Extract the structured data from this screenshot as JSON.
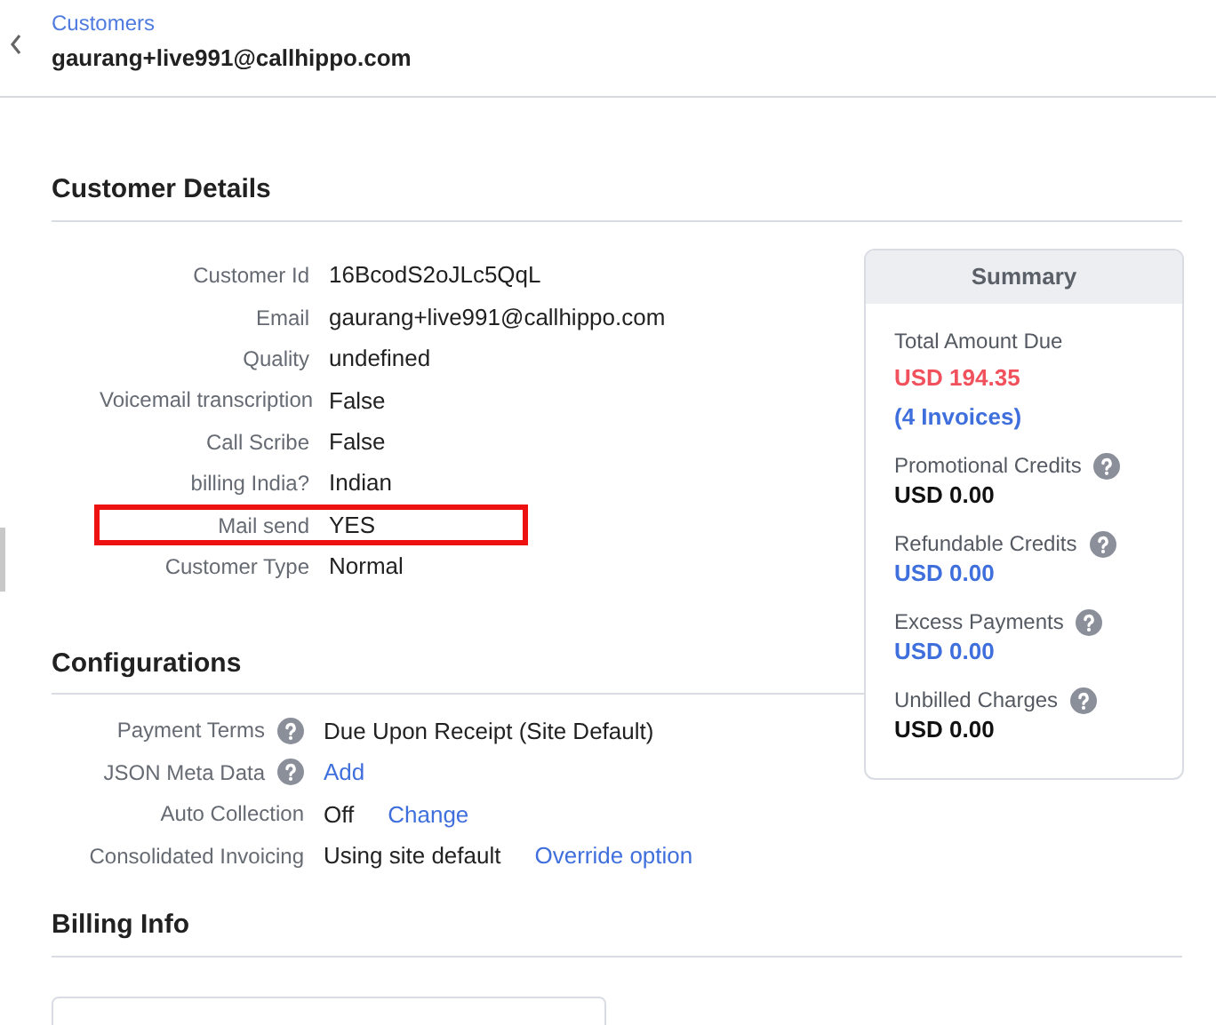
{
  "header": {
    "breadcrumb": "Customers",
    "title": "gaurang+live991@callhippo.com"
  },
  "customer_details": {
    "heading": "Customer Details",
    "rows": [
      {
        "label": "Customer Id",
        "value": "16BcodS2oJLc5QqL",
        "highlighted": false
      },
      {
        "label": "Email",
        "value": "gaurang+live991@callhippo.com",
        "highlighted": false
      },
      {
        "label": "Quality",
        "value": "undefined",
        "highlighted": false
      },
      {
        "label": "Voicemail transcription",
        "value": "False",
        "highlighted": false
      },
      {
        "label": "Call Scribe",
        "value": "False",
        "highlighted": false
      },
      {
        "label": "billing India?",
        "value": "Indian",
        "highlighted": false
      },
      {
        "label": "Mail send",
        "value": "YES",
        "highlighted": true
      },
      {
        "label": "Customer Type",
        "value": "Normal",
        "highlighted": false
      }
    ]
  },
  "summary": {
    "title": "Summary",
    "total": {
      "label": "Total Amount Due",
      "amount": "USD 194.35",
      "invoices": "(4 Invoices)"
    },
    "items": [
      {
        "label": "Promotional Credits",
        "amount": "USD 0.00",
        "kind": "plain"
      },
      {
        "label": "Refundable Credits",
        "amount": "USD 0.00",
        "kind": "link"
      },
      {
        "label": "Excess Payments",
        "amount": "USD 0.00",
        "kind": "link"
      },
      {
        "label": "Unbilled Charges",
        "amount": "USD 0.00",
        "kind": "plain"
      }
    ]
  },
  "configurations": {
    "heading": "Configurations",
    "rows": [
      {
        "label": "Payment Terms",
        "help": true,
        "value": "Due Upon Receipt (Site Default)",
        "kind": "text"
      },
      {
        "label": "JSON Meta Data",
        "help": true,
        "value": "Add",
        "kind": "link"
      },
      {
        "label": "Auto Collection",
        "help": false,
        "value": "Off",
        "kind": "text",
        "action": "Change"
      },
      {
        "label": "Consolidated Invoicing",
        "help": false,
        "value": "Using site default",
        "kind": "text",
        "action": "Override option"
      }
    ]
  },
  "billing_info": {
    "heading": "Billing Info"
  }
}
